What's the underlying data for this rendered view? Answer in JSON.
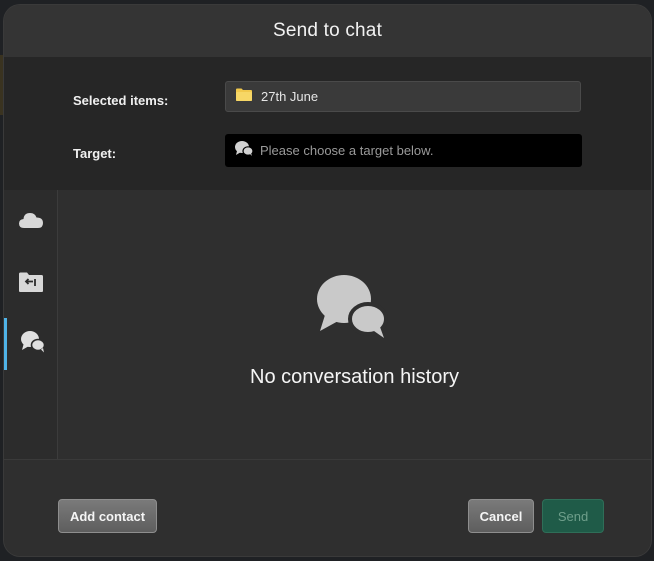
{
  "dialog": {
    "title": "Send to chat"
  },
  "form": {
    "selected_label": "Selected items:",
    "selected_value": "27th June",
    "selected_icon": "folder-icon",
    "target_label": "Target:",
    "target_placeholder": "Please choose a target below.",
    "target_icon": "chat-bubbles-icon"
  },
  "sidebar": {
    "items": [
      {
        "icon": "cloud-icon",
        "active": false
      },
      {
        "icon": "incoming-shares-icon",
        "active": false
      },
      {
        "icon": "chat-bubbles-icon",
        "active": true
      }
    ]
  },
  "main": {
    "empty_icon": "chat-bubbles-icon",
    "empty_text": "No conversation history"
  },
  "footer": {
    "add_contact_label": "Add contact",
    "cancel_label": "Cancel",
    "send_label": "Send"
  },
  "colors": {
    "accent": "#4fb3e8",
    "send_button": "#1f5b48",
    "folder": "#f2c94c"
  }
}
